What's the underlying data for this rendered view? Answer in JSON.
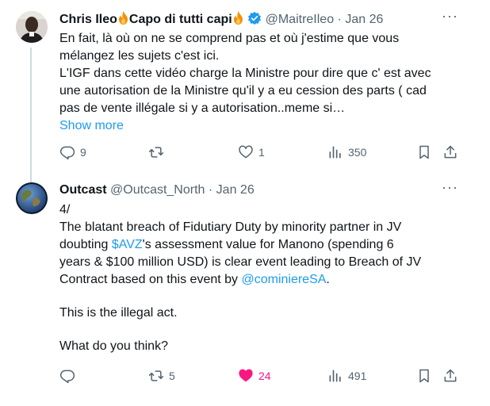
{
  "tweets": [
    {
      "display_name_part1": "Chris Ileo",
      "display_name_part2": "Capo di tutti capi",
      "handle": "@MaitreIleo",
      "separator": "·",
      "date": "Jan 26",
      "more_label": "···",
      "lines": [
        "En fait, là où on ne se comprend pas et où j'estime que vous",
        "mélangez les sujets c'est ici.",
        "L'IGF dans cette vidéo charge la Ministre pour dire que c' est avec",
        "une autorisation de la Ministre qu'il y a eu cession des parts ( cad",
        "pas de vente illégale si y a autorisation..meme si…"
      ],
      "show_more": "Show more",
      "replies": "9",
      "retweets": "",
      "likes": "1",
      "views": "350"
    },
    {
      "display_name": "Outcast",
      "handle": "@Outcast_North",
      "separator": "·",
      "date": "Jan 26",
      "more_label": "···",
      "line_1": "4/",
      "p1_a": "The blatant breach of Fidutiary Duty by minority partner in JV",
      "p1_b": "doubting ",
      "cashtag": "$AVZ",
      "p1_c": "'s assessment value for Manono (spending 6",
      "p1_d": "years & $100 million USD) is clear event leading to Breach of JV",
      "p1_e": "Contract based on this event by ",
      "mention": "@cominiereSA",
      "p1_f": ".",
      "p2": "This is the illegal act.",
      "p3": "What do you think?",
      "replies": "",
      "retweets": "5",
      "likes": "24",
      "views": "491"
    }
  ],
  "colors": {
    "text": "#0f1419",
    "muted": "#536471",
    "link": "#1d9bf0",
    "like_active": "#f91880",
    "verified": "#1d9bf0",
    "thread_line": "#cfd9de"
  },
  "icons": [
    "reply-icon",
    "retweet-icon",
    "like-icon",
    "views-icon",
    "bookmark-icon",
    "share-icon",
    "verified-badge-icon",
    "fire-emoji-icon",
    "more-icon"
  ]
}
